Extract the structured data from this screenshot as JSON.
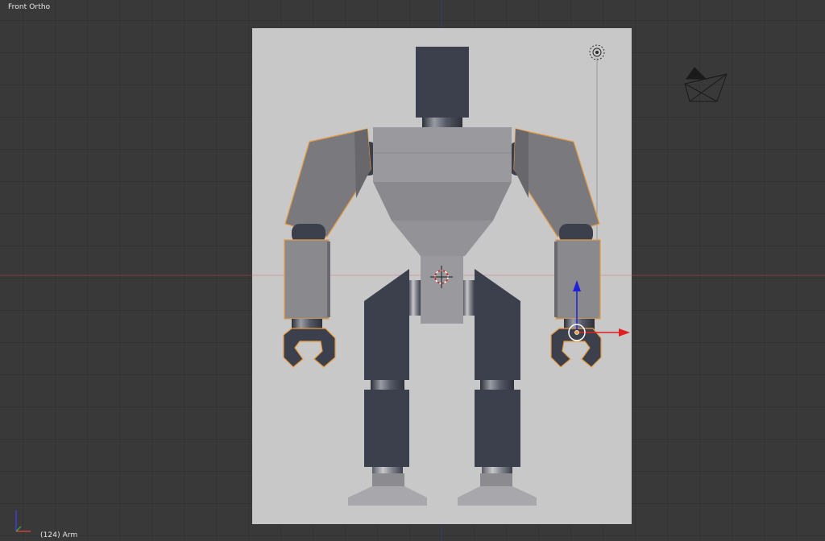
{
  "viewport": {
    "view_name": "Front Ortho",
    "frame_info": "(124) Arm"
  },
  "axes": {
    "x_color": "#c84040",
    "y_color": "#3a3aa8",
    "manip_x_color": "#e02020",
    "manip_z_color": "#2020d8"
  },
  "icons": [
    "camera-icon",
    "lamp-icon",
    "3d-cursor-icon",
    "transform-manipulator-icon",
    "axis-orientation-icon"
  ],
  "colors": {
    "background": "#393939",
    "backdrop_plane": "#c8c8c8",
    "robot_dark": "#3c3f4c",
    "robot_light": "#8e8e92",
    "selection_outline": "#e89a40"
  }
}
